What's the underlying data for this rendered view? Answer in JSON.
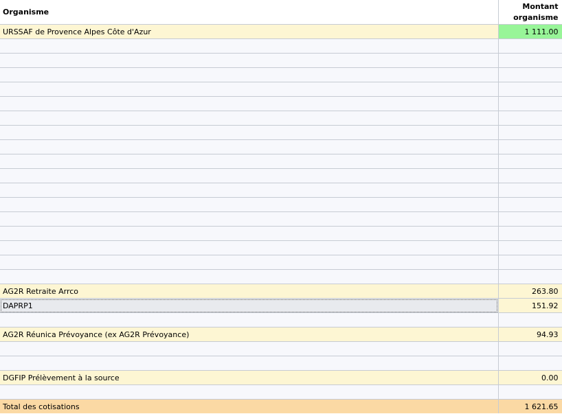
{
  "header": {
    "col_org": "Organisme",
    "col_amount_line1": "Montant",
    "col_amount_line2": "organisme"
  },
  "rows": [
    {
      "type": "org",
      "label": "URSSAF de Provence Alpes Côte d'Azur",
      "amount": "1 111.00",
      "highlight": "green"
    },
    {
      "type": "empty"
    },
    {
      "type": "empty"
    },
    {
      "type": "empty"
    },
    {
      "type": "empty"
    },
    {
      "type": "empty"
    },
    {
      "type": "empty"
    },
    {
      "type": "empty"
    },
    {
      "type": "empty"
    },
    {
      "type": "empty"
    },
    {
      "type": "empty"
    },
    {
      "type": "empty"
    },
    {
      "type": "empty"
    },
    {
      "type": "empty"
    },
    {
      "type": "empty"
    },
    {
      "type": "empty"
    },
    {
      "type": "empty"
    },
    {
      "type": "empty"
    },
    {
      "type": "org",
      "label": "AG2R Retraite Arrco",
      "amount": "263.80"
    },
    {
      "type": "sel",
      "label": "DAPRP1",
      "amount": "151.92"
    },
    {
      "type": "empty"
    },
    {
      "type": "org",
      "label": "AG2R Réunica Prévoyance (ex AG2R Prévoyance)",
      "amount": "94.93"
    },
    {
      "type": "empty"
    },
    {
      "type": "empty"
    },
    {
      "type": "org",
      "label": "DGFIP Prélèvement à la source",
      "amount": "0.00"
    },
    {
      "type": "empty"
    }
  ],
  "total": {
    "label": "Total des cotisations",
    "amount": "1 621.65"
  },
  "colors": {
    "org_row": "#fdf6d3",
    "empty_row": "#f7f8fc",
    "green": "#98f598",
    "total_row": "#fbd9a4"
  }
}
